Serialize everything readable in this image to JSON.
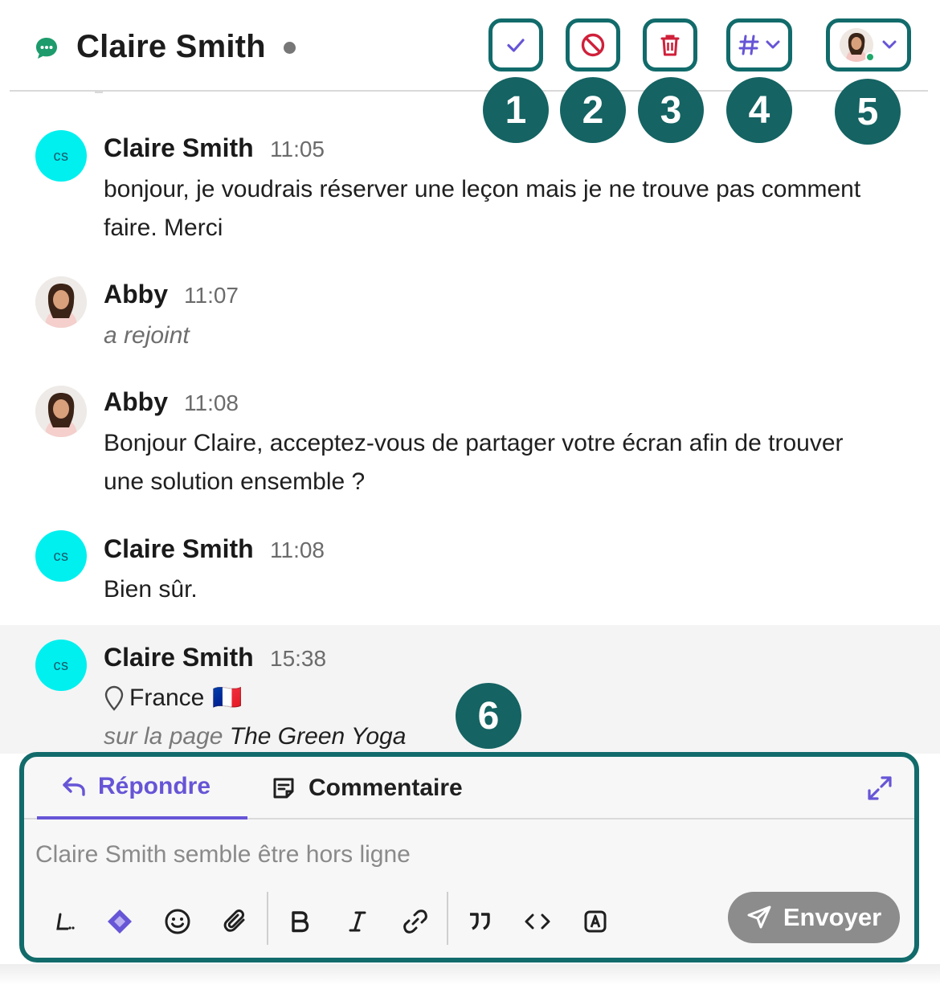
{
  "header": {
    "title": "Claire Smith",
    "icons": [
      "chat-bubble-icon",
      "check-icon",
      "block-icon",
      "trash-icon",
      "hash-icon",
      "chevron-down-icon",
      "agent-avatar"
    ],
    "colors": {
      "accent": "#6655d6",
      "danger": "#d0203a",
      "teal_highlight": "#126b6b",
      "online": "#1fa86a"
    }
  },
  "badges": [
    "1",
    "2",
    "3",
    "4",
    "5",
    "6"
  ],
  "messages": [
    {
      "author": "Claire Smith",
      "time": "11:05",
      "avatar_initials": "cs",
      "text": "bonjour, je voudrais réserver une leçon mais je ne trouve pas comment faire. Merci"
    },
    {
      "author": "Abby",
      "time": "11:07",
      "text": "a rejoint"
    },
    {
      "author": "Abby",
      "time": "11:08",
      "text": "Bonjour Claire, acceptez-vous de partager votre écran afin de trouver une solution ensemble ?"
    },
    {
      "author": "Claire Smith",
      "time": "11:08",
      "avatar_initials": "cs",
      "text": "Bien sûr."
    },
    {
      "author": "Claire Smith",
      "time": "15:38",
      "avatar_initials": "cs",
      "location": "France",
      "flag": "🇫🇷",
      "page_prefix": "sur la page",
      "page_name": "The Green Yoga"
    }
  ],
  "composer": {
    "tab_reply": "Répondre",
    "tab_comment": "Commentaire",
    "placeholder": "Claire Smith semble être hors ligne",
    "send_label": "Envoyer",
    "toolbar_icons": [
      "shortcut-icon",
      "ai-icon",
      "emoji-icon",
      "attachment-icon",
      "bold-icon",
      "italic-icon",
      "link-icon",
      "quote-icon",
      "code-icon",
      "variable-icon"
    ]
  }
}
